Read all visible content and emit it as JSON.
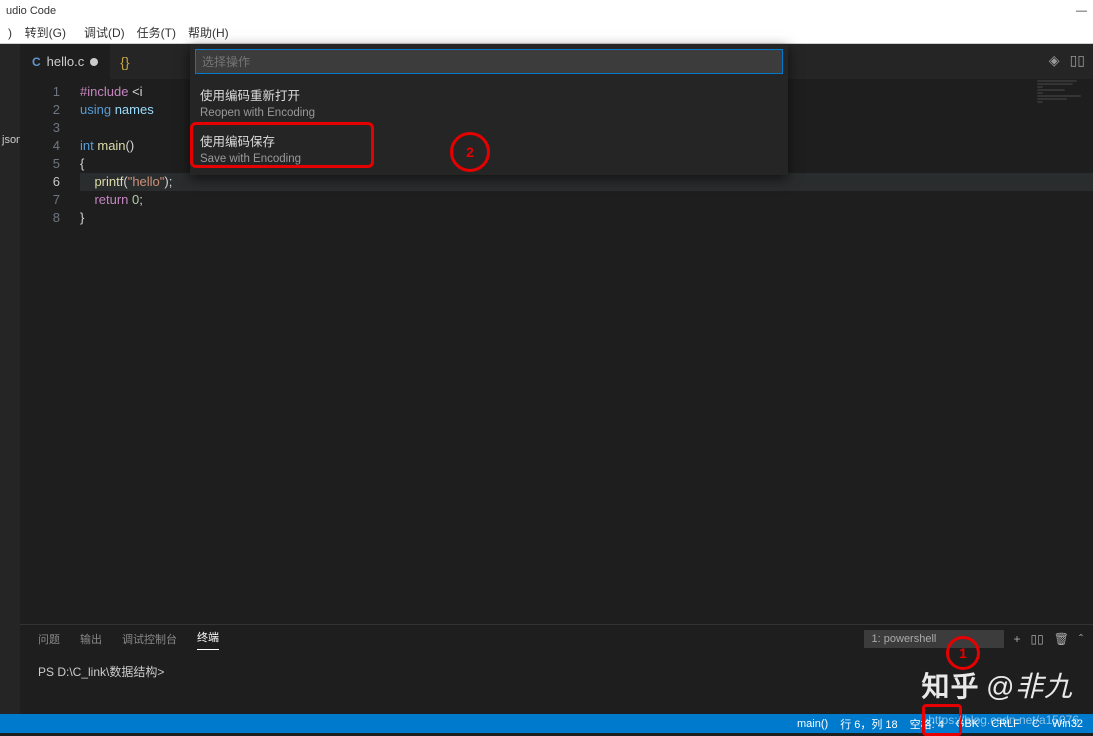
{
  "window": {
    "title": "udio Code",
    "min": "—",
    "restore": "▭",
    "close": "×"
  },
  "menubar": {
    "go": "转到(G)",
    "debug": "调试(D)",
    "tasks": "任务(T)",
    "help": "帮助(H)"
  },
  "sidebar": {
    "json": "json"
  },
  "tabs": {
    "file": "hello.c",
    "c_icon": "C",
    "braces": "{}"
  },
  "palette": {
    "placeholder": "选择操作",
    "items": [
      {
        "main": "使用编码重新打开",
        "sub": "Reopen with Encoding"
      },
      {
        "main": "使用编码保存",
        "sub": "Save with Encoding"
      }
    ]
  },
  "code": {
    "lines": [
      {
        "n": "1",
        "html": "<span class='kw'>#include</span> <span class='punc'>&lt;i</span>"
      },
      {
        "n": "2",
        "html": "<span class='kw2'>using</span> <span class='id'>names</span>"
      },
      {
        "n": "3",
        "html": ""
      },
      {
        "n": "4",
        "html": "<span class='kw2'>int</span> <span class='fn'>main</span><span class='punc'>()</span>"
      },
      {
        "n": "5",
        "html": "<span class='punc'>{</span>"
      },
      {
        "n": "6",
        "html": "    <span class='fn'>printf</span><span class='punc'>(</span><span class='str'>\"hello\"</span><span class='punc'>);</span>",
        "current": true
      },
      {
        "n": "7",
        "html": "    <span class='kw'>return</span> <span class='num'>0</span><span class='punc'>;</span>"
      },
      {
        "n": "8",
        "html": "<span class='punc'>}</span>"
      }
    ]
  },
  "panel": {
    "tabs": {
      "problems": "问题",
      "output": "输出",
      "debug": "调试控制台",
      "terminal": "终端"
    },
    "selector": "1: powershell",
    "prompt": "PS D:\\C_link\\数据结构>"
  },
  "statusbar": {
    "func": "main()",
    "pos": "行 6，列 18",
    "spaces": "空格: 4",
    "encoding": "GBK",
    "eol": "CRLF",
    "lang": "C",
    "os": "Win32"
  },
  "annotations": {
    "circle1": "1",
    "circle2": "2"
  },
  "watermark": {
    "logo": "知乎",
    "text": "@非九"
  },
  "blog": "https://blog.csdn.net/a15076"
}
